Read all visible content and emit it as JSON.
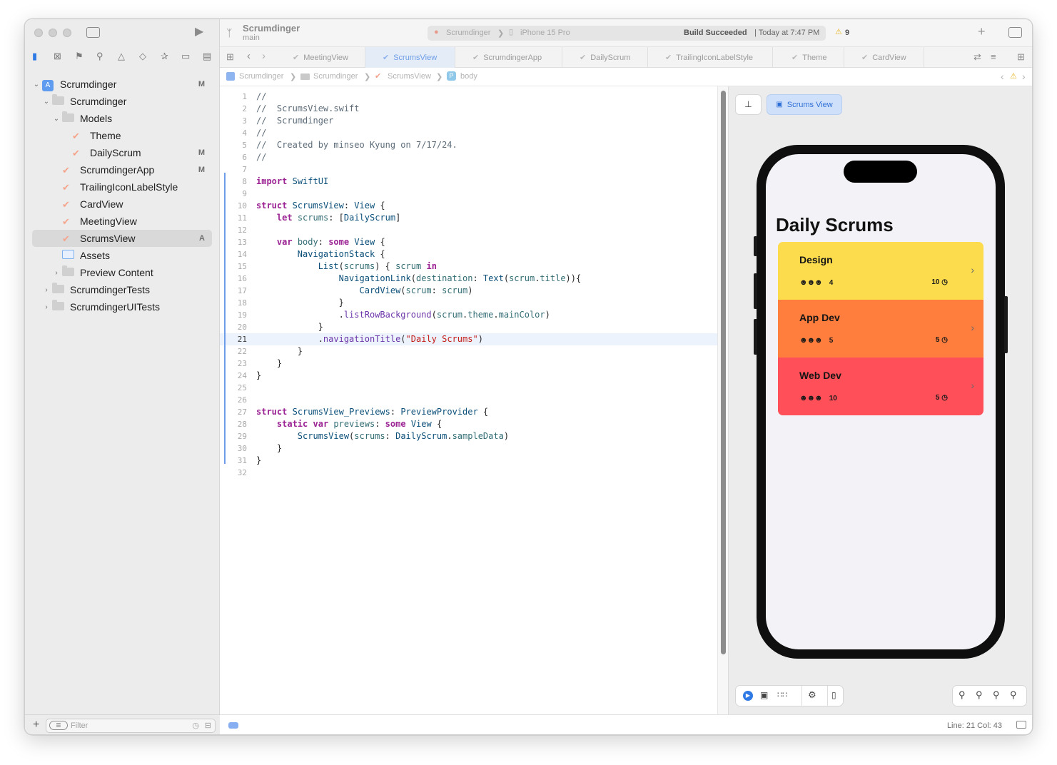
{
  "project": {
    "name": "Scrumdinger",
    "branch": "main"
  },
  "activity": {
    "scheme": "Scrumdinger",
    "device": "iPhone 15 Pro",
    "status": "Build Succeeded",
    "time": "| Today at 7:47 PM",
    "warnings": "9"
  },
  "tabs": [
    "MeetingView",
    "ScrumsView",
    "ScrumdingerApp",
    "DailyScrum",
    "TrailingIconLabelStyle",
    "Theme",
    "CardView"
  ],
  "jumpbar": [
    "Scrumdinger",
    "Scrumdinger",
    "ScrumsView",
    "body"
  ],
  "navigator": {
    "items": [
      {
        "label": "Scrumdinger",
        "badge": "M"
      },
      {
        "label": "Scrumdinger",
        "badge": ""
      },
      {
        "label": "Models",
        "badge": ""
      },
      {
        "label": "Theme",
        "badge": ""
      },
      {
        "label": "DailyScrum",
        "badge": "M"
      },
      {
        "label": "ScrumdingerApp",
        "badge": "M"
      },
      {
        "label": "TrailingIconLabelStyle",
        "badge": ""
      },
      {
        "label": "CardView",
        "badge": ""
      },
      {
        "label": "MeetingView",
        "badge": ""
      },
      {
        "label": "ScrumsView",
        "badge": "A"
      },
      {
        "label": "Assets",
        "badge": ""
      },
      {
        "label": "Preview Content",
        "badge": ""
      },
      {
        "label": "ScrumdingerTests",
        "badge": ""
      },
      {
        "label": "ScrumdingerUITests",
        "badge": ""
      }
    ],
    "filter_placeholder": "Filter"
  },
  "code_lines": [
    "//",
    "//  ScrumsView.swift",
    "//  Scrumdinger",
    "//",
    "//  Created by minseo Kyung on 7/17/24.",
    "//",
    "",
    "import SwiftUI",
    "",
    "struct ScrumsView: View {",
    "    let scrums: [DailyScrum]",
    "",
    "    var body: some View {",
    "        NavigationStack {",
    "            List(scrums) { scrum in",
    "                NavigationLink(destination: Text(scrum.title)){",
    "                    CardView(scrum: scrum)",
    "                }",
    "                .listRowBackground(scrum.theme.mainColor)",
    "            }",
    "            .navigationTitle(\"Daily Scrums\")",
    "        }",
    "    }",
    "}",
    "",
    "",
    "struct ScrumsView_Previews: PreviewProvider {",
    "    static var previews: some View {",
    "        ScrumsView(scrums: DailyScrum.sampleData)",
    "    }",
    "}",
    ""
  ],
  "current_line": 21,
  "preview": {
    "tab_label": "Scrums View",
    "nav_title": "Daily Scrums",
    "scrums": [
      {
        "title": "Design",
        "attendees": "4",
        "length": "10",
        "color": "#fcdc4d"
      },
      {
        "title": "App Dev",
        "attendees": "5",
        "length": "5",
        "color": "#ff7d3d"
      },
      {
        "title": "Web Dev",
        "attendees": "10",
        "length": "5",
        "color": "#ff4f58"
      }
    ]
  },
  "status": {
    "cursor": "Line: 21  Col: 43"
  },
  "colors": {
    "accent": "#2e6fd6",
    "change_bar": "#6d9ce8"
  }
}
